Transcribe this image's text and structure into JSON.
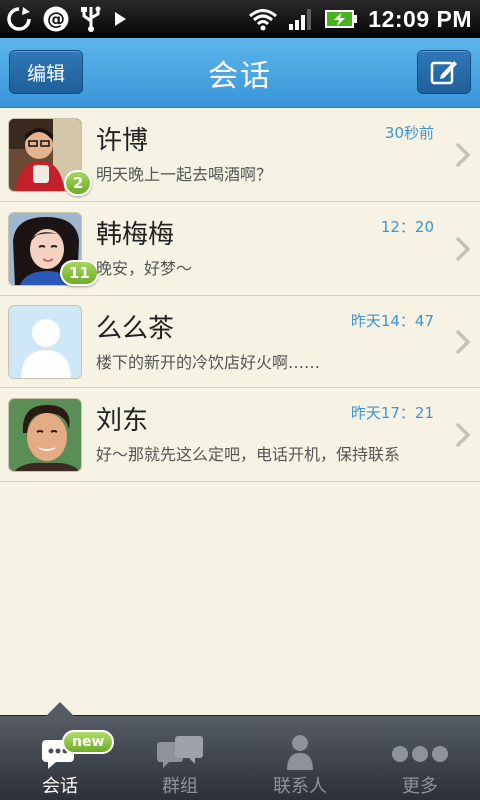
{
  "status_bar": {
    "time": "12:09 PM",
    "icons": [
      "sync-icon",
      "at-icon",
      "usb-icon",
      "play-icon",
      "wifi-icon",
      "signal-icon",
      "battery-charging-icon"
    ]
  },
  "header": {
    "edit_label": "编辑",
    "title": "会话",
    "compose_icon": "compose-icon"
  },
  "conversations": [
    {
      "name": "许博",
      "time": "30秒前",
      "preview": "明天晚上一起去喝酒啊？",
      "unread": "2",
      "avatar": "photo"
    },
    {
      "name": "韩梅梅",
      "time": "12：20",
      "preview": "晚安，好梦～",
      "unread": "11",
      "avatar": "photo"
    },
    {
      "name": "么么茶",
      "time": "昨天14：47",
      "preview": "楼下的新开的冷饮店好火啊……",
      "unread": "",
      "avatar": "default-avatar"
    },
    {
      "name": "刘东",
      "time": "昨天17：21",
      "preview": "好～那就先这么定吧，电话开机，保持联系",
      "unread": "",
      "avatar": "photo"
    }
  ],
  "tabs": [
    {
      "label": "会话",
      "icon": "chat-bubbles-icon",
      "active": true,
      "badge": "new"
    },
    {
      "label": "群组",
      "icon": "group-chat-icon",
      "active": false
    },
    {
      "label": "联系人",
      "icon": "contact-person-icon",
      "active": false
    },
    {
      "label": "更多",
      "icon": "more-dots-icon",
      "active": false
    }
  ],
  "colors": {
    "header_blue": "#3a95d9",
    "time_blue": "#3e95d6",
    "badge_green": "#6fac25",
    "list_background": "#f6f2e4"
  }
}
